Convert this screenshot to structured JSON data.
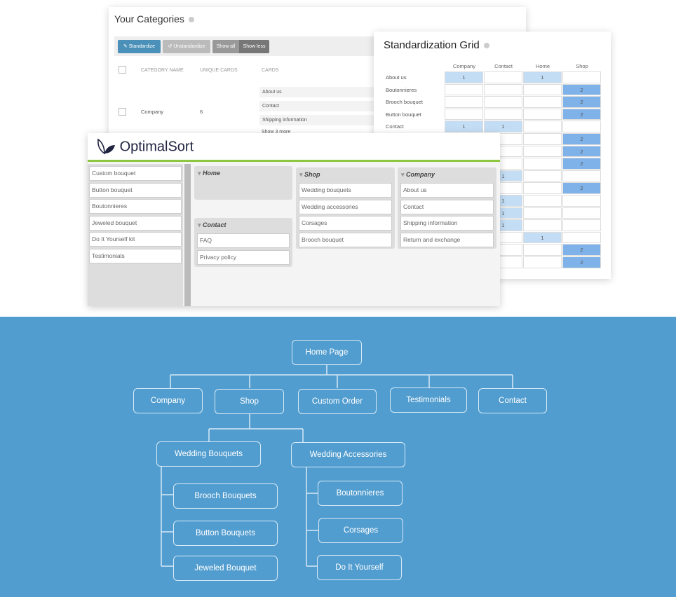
{
  "categories": {
    "title": "Your Categories",
    "toolbar": {
      "standardize": "Standardize",
      "unstandardize": "Unstandardize",
      "show_all": "Show all",
      "show_less": "Show less"
    },
    "headers": [
      "CATEGORY NAME",
      "UNIQUE CARDS",
      "CARDS"
    ],
    "row": {
      "name": "Company",
      "unique_cards": "6",
      "cards": [
        "About us",
        "Contact",
        "Shipping information"
      ],
      "more": "Show 3 more"
    }
  },
  "grid": {
    "title": "Standardization Grid",
    "columns": [
      "Company",
      "Contact",
      "Home",
      "Shop"
    ],
    "rows": [
      {
        "label": "About us",
        "values": [
          1,
          null,
          1,
          null
        ]
      },
      {
        "label": "Boutonnieres",
        "values": [
          null,
          null,
          null,
          2
        ]
      },
      {
        "label": "Brooch bouquet",
        "values": [
          null,
          null,
          null,
          2
        ]
      },
      {
        "label": "Button bouquet",
        "values": [
          null,
          null,
          null,
          2
        ]
      },
      {
        "label": "Contact",
        "values": [
          1,
          1,
          null,
          null
        ]
      },
      {
        "label": "",
        "values": [
          null,
          null,
          null,
          2
        ]
      },
      {
        "label": "",
        "values": [
          null,
          null,
          null,
          2
        ]
      },
      {
        "label": "",
        "values": [
          null,
          null,
          null,
          2
        ]
      },
      {
        "label": "",
        "values": [
          null,
          1,
          null,
          null
        ]
      },
      {
        "label": "",
        "values": [
          null,
          null,
          null,
          2
        ]
      },
      {
        "label": "",
        "values": [
          null,
          1,
          null,
          null
        ]
      },
      {
        "label": "",
        "values": [
          null,
          1,
          null,
          null
        ]
      },
      {
        "label": "",
        "values": [
          null,
          1,
          null,
          null
        ]
      },
      {
        "label": "",
        "values": [
          null,
          null,
          1,
          null
        ]
      },
      {
        "label": "",
        "values": [
          null,
          null,
          null,
          2
        ]
      },
      {
        "label": "",
        "values": [
          null,
          null,
          null,
          2
        ]
      }
    ],
    "colors": {
      "one": "#c3ddf5",
      "two": "#7fb2e8"
    }
  },
  "optimalsort": {
    "logo": "OptimalSort",
    "unsorted": [
      "Custom bouquet",
      "Button bouquet",
      "Boutonnieres",
      "Jeweled bouquet",
      "Do It Yourself kit",
      "Testimonials"
    ],
    "groups": [
      {
        "name": "Home",
        "cards": []
      },
      {
        "name": "Contact",
        "cards": [
          "FAQ",
          "Privacy policy"
        ]
      },
      {
        "name": "Shop",
        "cards": [
          "Wedding bouquets",
          "Wedding accessories",
          "Corsages",
          "Brooch bouquet"
        ]
      },
      {
        "name": "Company",
        "cards": [
          "About us",
          "Contact",
          "Shipping information",
          "Return and exchange"
        ]
      }
    ],
    "accent": "#8dc63f"
  },
  "sitemap": {
    "root": "Home Page",
    "level1": [
      "Company",
      "Shop",
      "Custom Order",
      "Testimonials",
      "Contact"
    ],
    "shop_children": [
      "Wedding Bouquets",
      "Wedding Accessories"
    ],
    "bouquets_children": [
      "Brooch Bouquets",
      "Button Bouquets",
      "Jeweled  Bouquet"
    ],
    "accessories_children": [
      "Boutonnieres",
      "Corsages",
      "Do It Yourself"
    ],
    "background": "#529dcf"
  }
}
